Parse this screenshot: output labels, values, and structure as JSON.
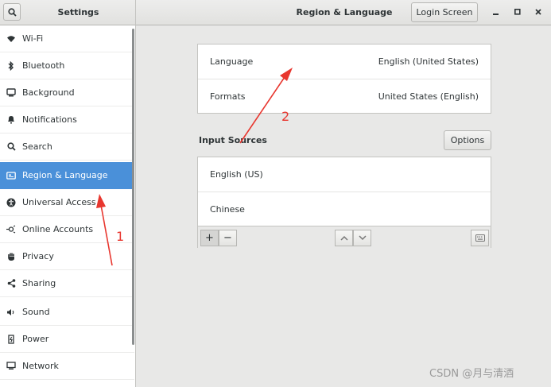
{
  "header": {
    "left_title": "Settings",
    "main_title": "Region & Language",
    "login_button": "Login Screen"
  },
  "sidebar": {
    "items": [
      {
        "label": "Wi-Fi",
        "icon": "wifi-icon"
      },
      {
        "label": "Bluetooth",
        "icon": "bluetooth-icon"
      },
      {
        "label": "Background",
        "icon": "background-icon"
      },
      {
        "label": "Notifications",
        "icon": "bell-icon"
      },
      {
        "label": "Search",
        "icon": "search-icon"
      },
      {
        "label": "Region & Language",
        "icon": "region-icon",
        "selected": true
      },
      {
        "label": "Universal Access",
        "icon": "accessibility-icon"
      },
      {
        "label": "Online Accounts",
        "icon": "online-accounts-icon"
      },
      {
        "label": "Privacy",
        "icon": "hand-icon"
      },
      {
        "label": "Sharing",
        "icon": "share-icon"
      },
      {
        "label": "Sound",
        "icon": "speaker-icon"
      },
      {
        "label": "Power",
        "icon": "power-icon"
      },
      {
        "label": "Network",
        "icon": "network-icon"
      }
    ]
  },
  "region": {
    "language_label": "Language",
    "language_value": "English (United States)",
    "formats_label": "Formats",
    "formats_value": "United States (English)"
  },
  "input_sources": {
    "title": "Input Sources",
    "options_button": "Options",
    "items": [
      "English (US)",
      "Chinese"
    ],
    "toolbar": {
      "add": "+",
      "remove": "−"
    }
  },
  "annotations": {
    "one": "1",
    "two": "2"
  },
  "watermark": "CSDN @月与清酒",
  "colors": {
    "accent": "#4a90d9",
    "annotation": "#e8372f"
  }
}
